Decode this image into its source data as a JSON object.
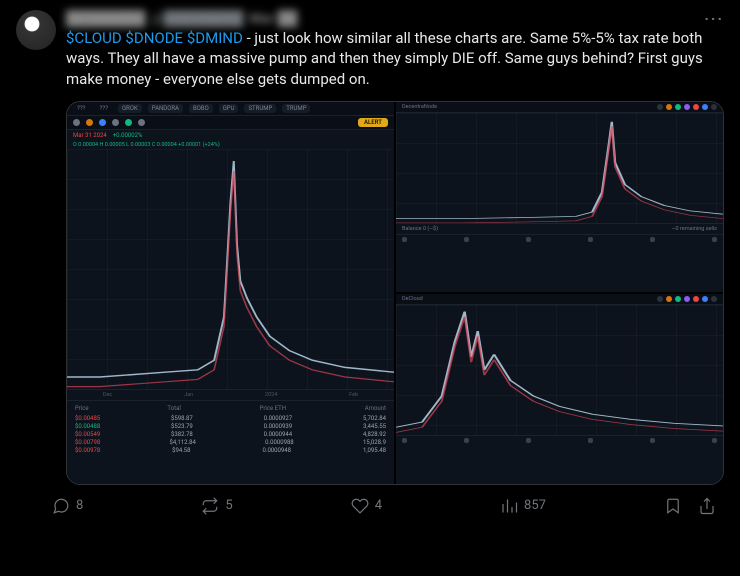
{
  "user": {
    "display_name": "████████",
    "handle": "@████████",
    "date": "Mar ██"
  },
  "more_label": "···",
  "body": {
    "tickers": [
      "$CLOUD",
      "$DNODE",
      "$DMIND"
    ],
    "text_after": " - just look how similar all these charts are. Same 5%-5% tax rate both ways. They all have a massive pump and then they simply DIE off. Same guys behind? First guys make money - everyone else gets dumped on."
  },
  "metrics": {
    "replies": "8",
    "reposts": "5",
    "likes": "4",
    "views": "857"
  },
  "chart_big": {
    "tabs": [
      "???",
      "???",
      "GROK",
      "PANDORA",
      "BOBO",
      "GPU",
      "STRUMP",
      "TRUMP"
    ],
    "active_tab": 2,
    "alert_label": "ALERT",
    "sub1_a": "Mar 31 2024",
    "sub1_b": "+0.00002%",
    "stats": "O 0.00004  H 0.00005  L 0.00003  C 0.00004  +0.00001 (+24%)",
    "xaxis": [
      "Dec",
      "Jan",
      "2024",
      "Feb"
    ],
    "table": {
      "cols": [
        "Price",
        "Total",
        "Price ETH",
        "Amount"
      ],
      "rows": [
        {
          "price": "$0.00485",
          "total": "$598.87",
          "eth": "0.0000927",
          "amount": "5,702.84",
          "side": "r"
        },
        {
          "price": "$0.00488",
          "total": "$523.79",
          "eth": "0.0000939",
          "amount": "3,445.55",
          "side": "g"
        },
        {
          "price": "$0.00549",
          "total": "$382.78",
          "eth": "0.0000944",
          "amount": "4,828.92",
          "side": "r"
        },
        {
          "price": "$0.00798",
          "total": "$4,112.84",
          "eth": "0.0000988",
          "amount": "15,028.9",
          "side": "r"
        },
        {
          "price": "$0.00978",
          "total": "$94.58",
          "eth": "0.0000948",
          "amount": "1,095.48",
          "side": "r"
        }
      ]
    }
  },
  "chart_top_right": {
    "title": "DecentraNode",
    "footer_l": "Balance 0 (~$)",
    "footer_r": "~0 remaining sells"
  },
  "chart_bottom_right": {
    "title": "DeCloud"
  },
  "chart_data": [
    {
      "type": "line",
      "label": "big-chart-pump-dump",
      "x": [
        0,
        10,
        20,
        30,
        40,
        45,
        48,
        50,
        51,
        52,
        53,
        55,
        58,
        62,
        68,
        75,
        85,
        100
      ],
      "y": [
        5,
        5,
        6,
        7,
        8,
        12,
        30,
        78,
        95,
        60,
        45,
        38,
        30,
        22,
        16,
        12,
        9,
        7
      ],
      "ylim": [
        0,
        100
      ]
    },
    {
      "type": "line",
      "label": "top-right-pump-dump",
      "x": [
        0,
        20,
        40,
        55,
        60,
        63,
        65,
        66,
        67,
        70,
        75,
        82,
        90,
        100
      ],
      "y": [
        4,
        4,
        5,
        6,
        10,
        28,
        70,
        92,
        55,
        35,
        24,
        16,
        11,
        8
      ],
      "ylim": [
        0,
        100
      ]
    },
    {
      "type": "line",
      "label": "bottom-right-pump-dump",
      "x": [
        0,
        8,
        14,
        18,
        21,
        23,
        25,
        27,
        30,
        35,
        42,
        50,
        60,
        72,
        85,
        100
      ],
      "y": [
        6,
        10,
        30,
        72,
        95,
        60,
        80,
        50,
        62,
        42,
        30,
        22,
        16,
        12,
        9,
        7
      ],
      "ylim": [
        0,
        100
      ]
    }
  ]
}
